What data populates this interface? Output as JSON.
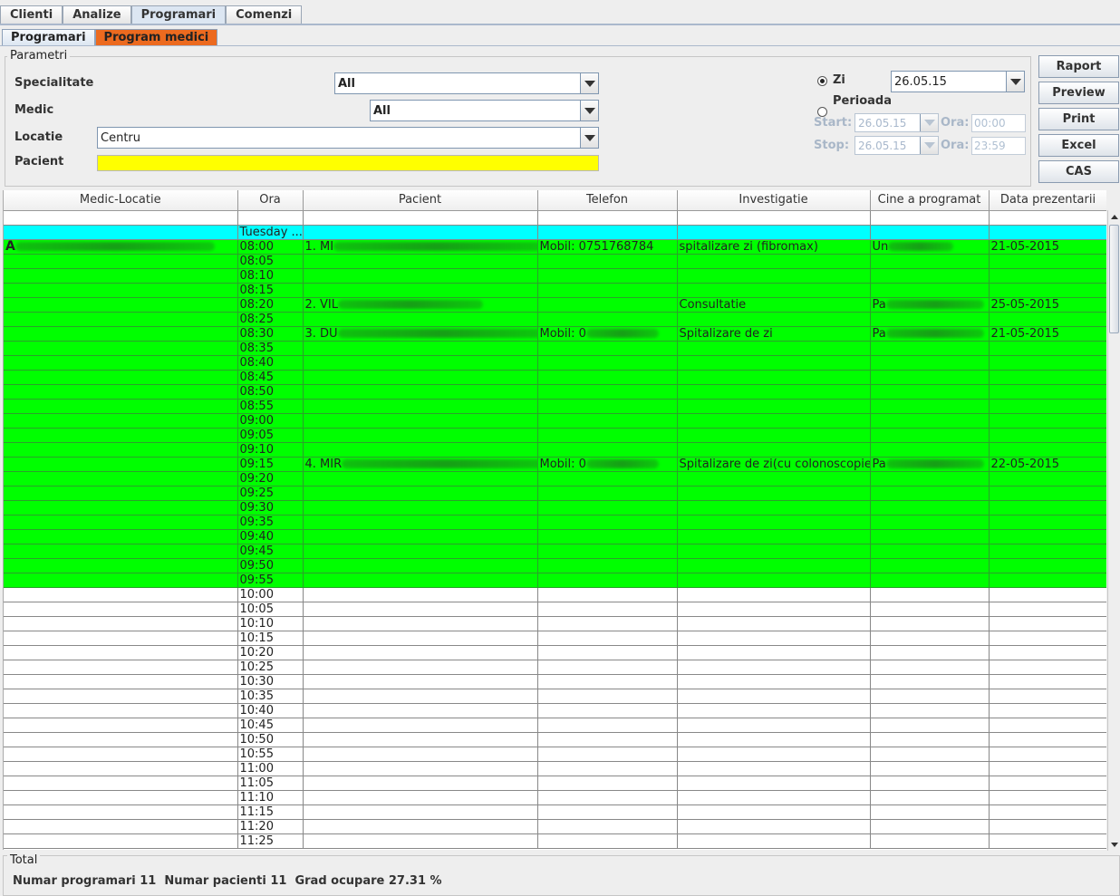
{
  "top_tabs": [
    "Clienti",
    "Analize",
    "Programari",
    "Comenzi"
  ],
  "sub_tabs": [
    "Programari",
    "Program medici"
  ],
  "params": {
    "legend": "Parametri",
    "specialitate_label": "Specialitate",
    "specialitate_value": "All",
    "medic_label": "Medic",
    "medic_value": "All",
    "locatie_label": "Locatie",
    "locatie_value": "Centru",
    "pacient_label": "Pacient",
    "pacient_value": "",
    "pacient_color": "#ffff00"
  },
  "date": {
    "zi_label": "Zi",
    "zi_value": "26.05.15",
    "perioada_label": "Perioada",
    "start_label": "Start:",
    "start_value": "26.05.15",
    "stop_label": "Stop:",
    "stop_value": "26.05.15",
    "ora_label": "Ora:",
    "ora_start": "00:00",
    "ora_stop": "23:59"
  },
  "buttons": [
    "Raport",
    "Preview",
    "Print",
    "Excel",
    "CAS"
  ],
  "table": {
    "columns": [
      "Medic-Locatie",
      "Ora",
      "Pacient",
      "Telefon",
      "Investigatie",
      "Cine a programat",
      "Data prezentarii"
    ],
    "day_row": "Tuesday ...",
    "rows": [
      {
        "medic": "A",
        "ora": "08:00",
        "pacient": "1. MI",
        "telefon": "Mobil: 0751768784",
        "investigatie": "spitalizare zi (fibromax)",
        "cine": "Un",
        "data": "21-05-2015",
        "color": "green"
      },
      {
        "ora": "08:05",
        "color": "green"
      },
      {
        "ora": "08:10",
        "color": "green"
      },
      {
        "ora": "08:15",
        "color": "green"
      },
      {
        "ora": "08:20",
        "pacient": "2. VIL",
        "investigatie": "Consultatie",
        "cine": "Pa",
        "data": "25-05-2015",
        "color": "green"
      },
      {
        "ora": "08:25",
        "color": "green"
      },
      {
        "ora": "08:30",
        "pacient": "3. DU",
        "telefon": "Mobil: 0",
        "investigatie": "Spitalizare de zi",
        "cine": "Pa",
        "data": "21-05-2015",
        "color": "green"
      },
      {
        "ora": "08:35",
        "color": "green"
      },
      {
        "ora": "08:40",
        "color": "green"
      },
      {
        "ora": "08:45",
        "color": "green"
      },
      {
        "ora": "08:50",
        "color": "green"
      },
      {
        "ora": "08:55",
        "color": "green"
      },
      {
        "ora": "09:00",
        "color": "green"
      },
      {
        "ora": "09:05",
        "color": "green"
      },
      {
        "ora": "09:10",
        "color": "green"
      },
      {
        "ora": "09:15",
        "pacient": "4. MIR",
        "telefon": "Mobil: 0",
        "investigatie": "Spitalizare de zi(cu colonoscopie)",
        "cine": "Pa",
        "data": "22-05-2015",
        "color": "green"
      },
      {
        "ora": "09:20",
        "color": "green"
      },
      {
        "ora": "09:25",
        "color": "green"
      },
      {
        "ora": "09:30",
        "color": "green"
      },
      {
        "ora": "09:35",
        "color": "green"
      },
      {
        "ora": "09:40",
        "color": "green"
      },
      {
        "ora": "09:45",
        "color": "green"
      },
      {
        "ora": "09:50",
        "color": "green"
      },
      {
        "ora": "09:55",
        "color": "green"
      },
      {
        "ora": "10:00",
        "color": "white"
      },
      {
        "ora": "10:05",
        "color": "white"
      },
      {
        "ora": "10:10",
        "color": "white"
      },
      {
        "ora": "10:15",
        "color": "white"
      },
      {
        "ora": "10:20",
        "color": "white"
      },
      {
        "ora": "10:25",
        "color": "white"
      },
      {
        "ora": "10:30",
        "color": "white"
      },
      {
        "ora": "10:35",
        "color": "white"
      },
      {
        "ora": "10:40",
        "color": "white"
      },
      {
        "ora": "10:45",
        "color": "white"
      },
      {
        "ora": "10:50",
        "color": "white"
      },
      {
        "ora": "10:55",
        "color": "white"
      },
      {
        "ora": "11:00",
        "color": "white"
      },
      {
        "ora": "11:05",
        "color": "white"
      },
      {
        "ora": "11:10",
        "color": "white"
      },
      {
        "ora": "11:15",
        "color": "white"
      },
      {
        "ora": "11:20",
        "color": "white"
      },
      {
        "ora": "11:25",
        "color": "white"
      }
    ]
  },
  "total": {
    "legend": "Total",
    "programari_label": "Numar programari",
    "programari_value": "11",
    "pacienti_label": "Numar pacienti",
    "pacienti_value": "11",
    "grad_label": "Grad ocupare",
    "grad_value": "27.31 %"
  },
  "colors": {
    "green_row": "#00ff00",
    "cyan_row": "#00ffff",
    "orange_tab": "#ec6a1f"
  }
}
